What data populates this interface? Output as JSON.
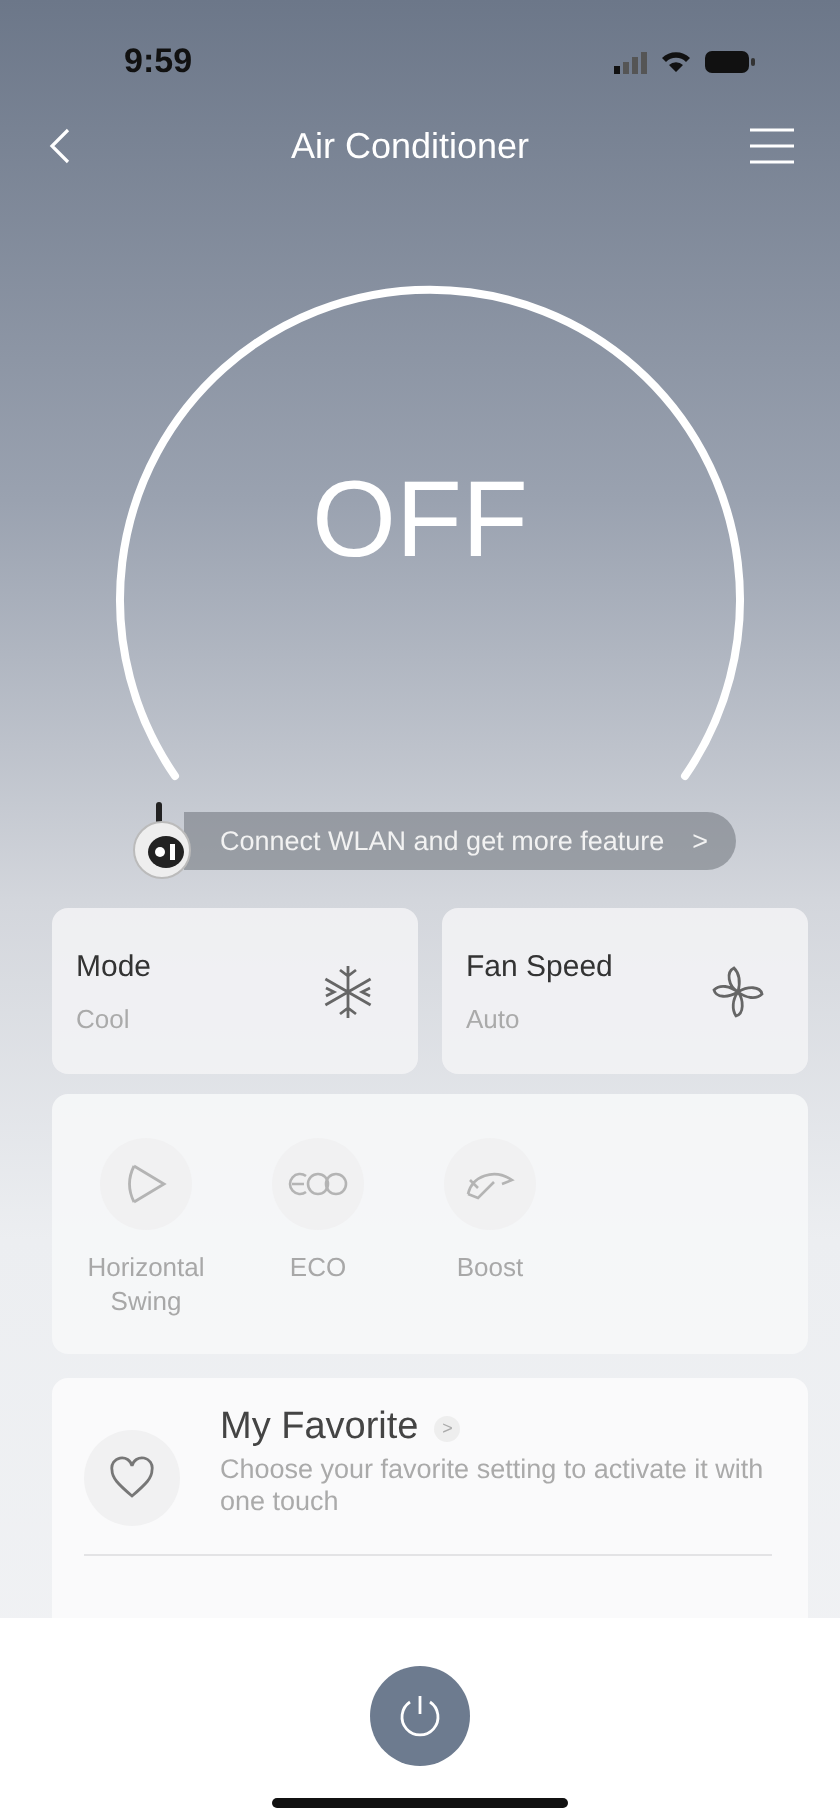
{
  "status_bar": {
    "time": "9:59"
  },
  "nav": {
    "title": "Air Conditioner"
  },
  "dial": {
    "power_state": "OFF"
  },
  "wlan_banner": {
    "text": "Connect WLAN and get more feature",
    "chevron": ">"
  },
  "tiles": [
    {
      "kind": "mode",
      "label": "Mode",
      "value": "Cool"
    },
    {
      "kind": "fan",
      "label": "Fan Speed",
      "value": "Auto"
    }
  ],
  "features": [
    {
      "kind": "swing",
      "label": "Horizontal Swing",
      "disabled": true
    },
    {
      "kind": "eco",
      "label": "ECO",
      "disabled": true
    },
    {
      "kind": "boost",
      "label": "Boost",
      "disabled": true
    }
  ],
  "favorite": {
    "title": "My Favorite",
    "chevron": ">",
    "description": "Choose your favorite setting to activate it with one touch"
  }
}
